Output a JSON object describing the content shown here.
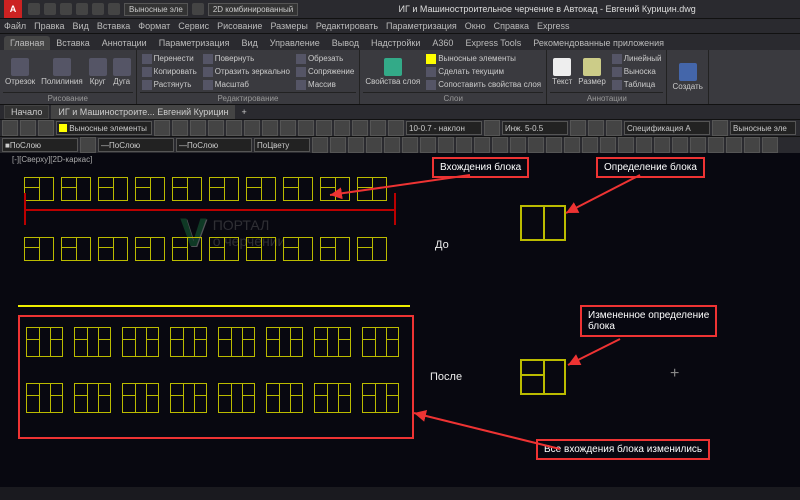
{
  "title": "ИГ и Машиностроительное черчение в Автокад - Евгений Курицин.dwg",
  "qat_selects": [
    "Выносные эле",
    "2D комбинированный"
  ],
  "menu": [
    "Файл",
    "Правка",
    "Вид",
    "Вставка",
    "Формат",
    "Сервис",
    "Рисование",
    "Размеры",
    "Редактировать",
    "Параметризация",
    "Окно",
    "Справка",
    "Express"
  ],
  "tabs": [
    "Главная",
    "Вставка",
    "Аннотации",
    "Параметризация",
    "Вид",
    "Управление",
    "Вывод",
    "Надстройки",
    "A360",
    "Express Tools",
    "Рекомендованные приложения"
  ],
  "draw": {
    "label": "Рисование",
    "btns": [
      "Отрезок",
      "Полилиния",
      "Круг",
      "Дуга"
    ]
  },
  "edit": {
    "label": "Редактирование",
    "items": [
      "Перенести",
      "Копировать",
      "Растянуть",
      "Повернуть",
      "Отразить зеркально",
      "Масштаб",
      "Обрезать",
      "Сопряжение",
      "Массив"
    ]
  },
  "layers": {
    "label": "Слои",
    "main": "Свойства слоя",
    "cur": "Выносные элементы",
    "items": [
      "Сделать текущим",
      "Сопоставить свойства слоя"
    ]
  },
  "anno": {
    "label": "Аннотации",
    "btns": [
      "Текст",
      "Размер"
    ],
    "items": [
      "Линейный",
      "Выноска",
      "Таблица"
    ]
  },
  "create": "Создать",
  "doctabs": [
    "Начало",
    "ИГ и Машиностроите... Евгений Курицин"
  ],
  "toolbar2_sel": "Выносные элементы",
  "props": [
    "ПоСлою",
    "ПоСлою",
    "ПоСлою",
    "ПоЦвету"
  ],
  "style_sels": [
    "10-0.7 - наклон",
    "Инж. 5-0.5",
    "Спецификация А",
    "Выносные эле"
  ],
  "viewport_label": "[-][Сверху][2D-каркас]",
  "callouts": {
    "inst": "Вхождения блока",
    "def": "Определение блока",
    "before": "До",
    "after": "После",
    "changed": "Измененное определение\nблока",
    "all": "Все вхождения блока изменились"
  },
  "wm": {
    "v": "V",
    "l1": "ПОРТАЛ",
    "l2": "о черчении"
  }
}
